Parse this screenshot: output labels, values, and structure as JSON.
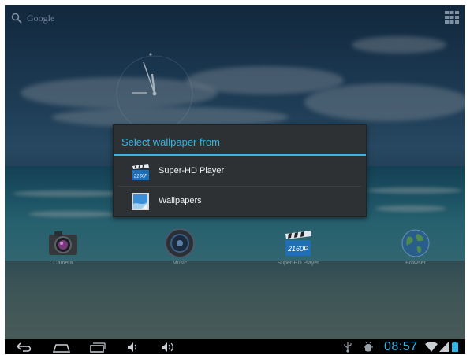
{
  "search": {
    "label": "Google",
    "icon": "search-icon"
  },
  "dialog": {
    "title": "Select wallpaper from",
    "accent_color": "#33b5e5",
    "items": [
      {
        "label": "Super-HD Player",
        "icon": "hd-player-icon"
      },
      {
        "label": "Wallpapers",
        "icon": "wallpapers-icon"
      }
    ]
  },
  "launcher": {
    "apps": [
      {
        "label": "Camera",
        "icon": "camera-icon"
      },
      {
        "label": "Music",
        "icon": "music-icon"
      },
      {
        "label": "Super-HD Player",
        "icon": "hd-player-icon"
      },
      {
        "label": "Browser",
        "icon": "globe-icon"
      }
    ]
  },
  "system_bar": {
    "time": "08:57",
    "icons": [
      "back-icon",
      "home-icon",
      "recent-apps-icon",
      "volume-down-icon",
      "volume-up-icon",
      "usb-icon",
      "debug-icon",
      "wifi-icon",
      "signal-icon",
      "battery-icon"
    ]
  }
}
